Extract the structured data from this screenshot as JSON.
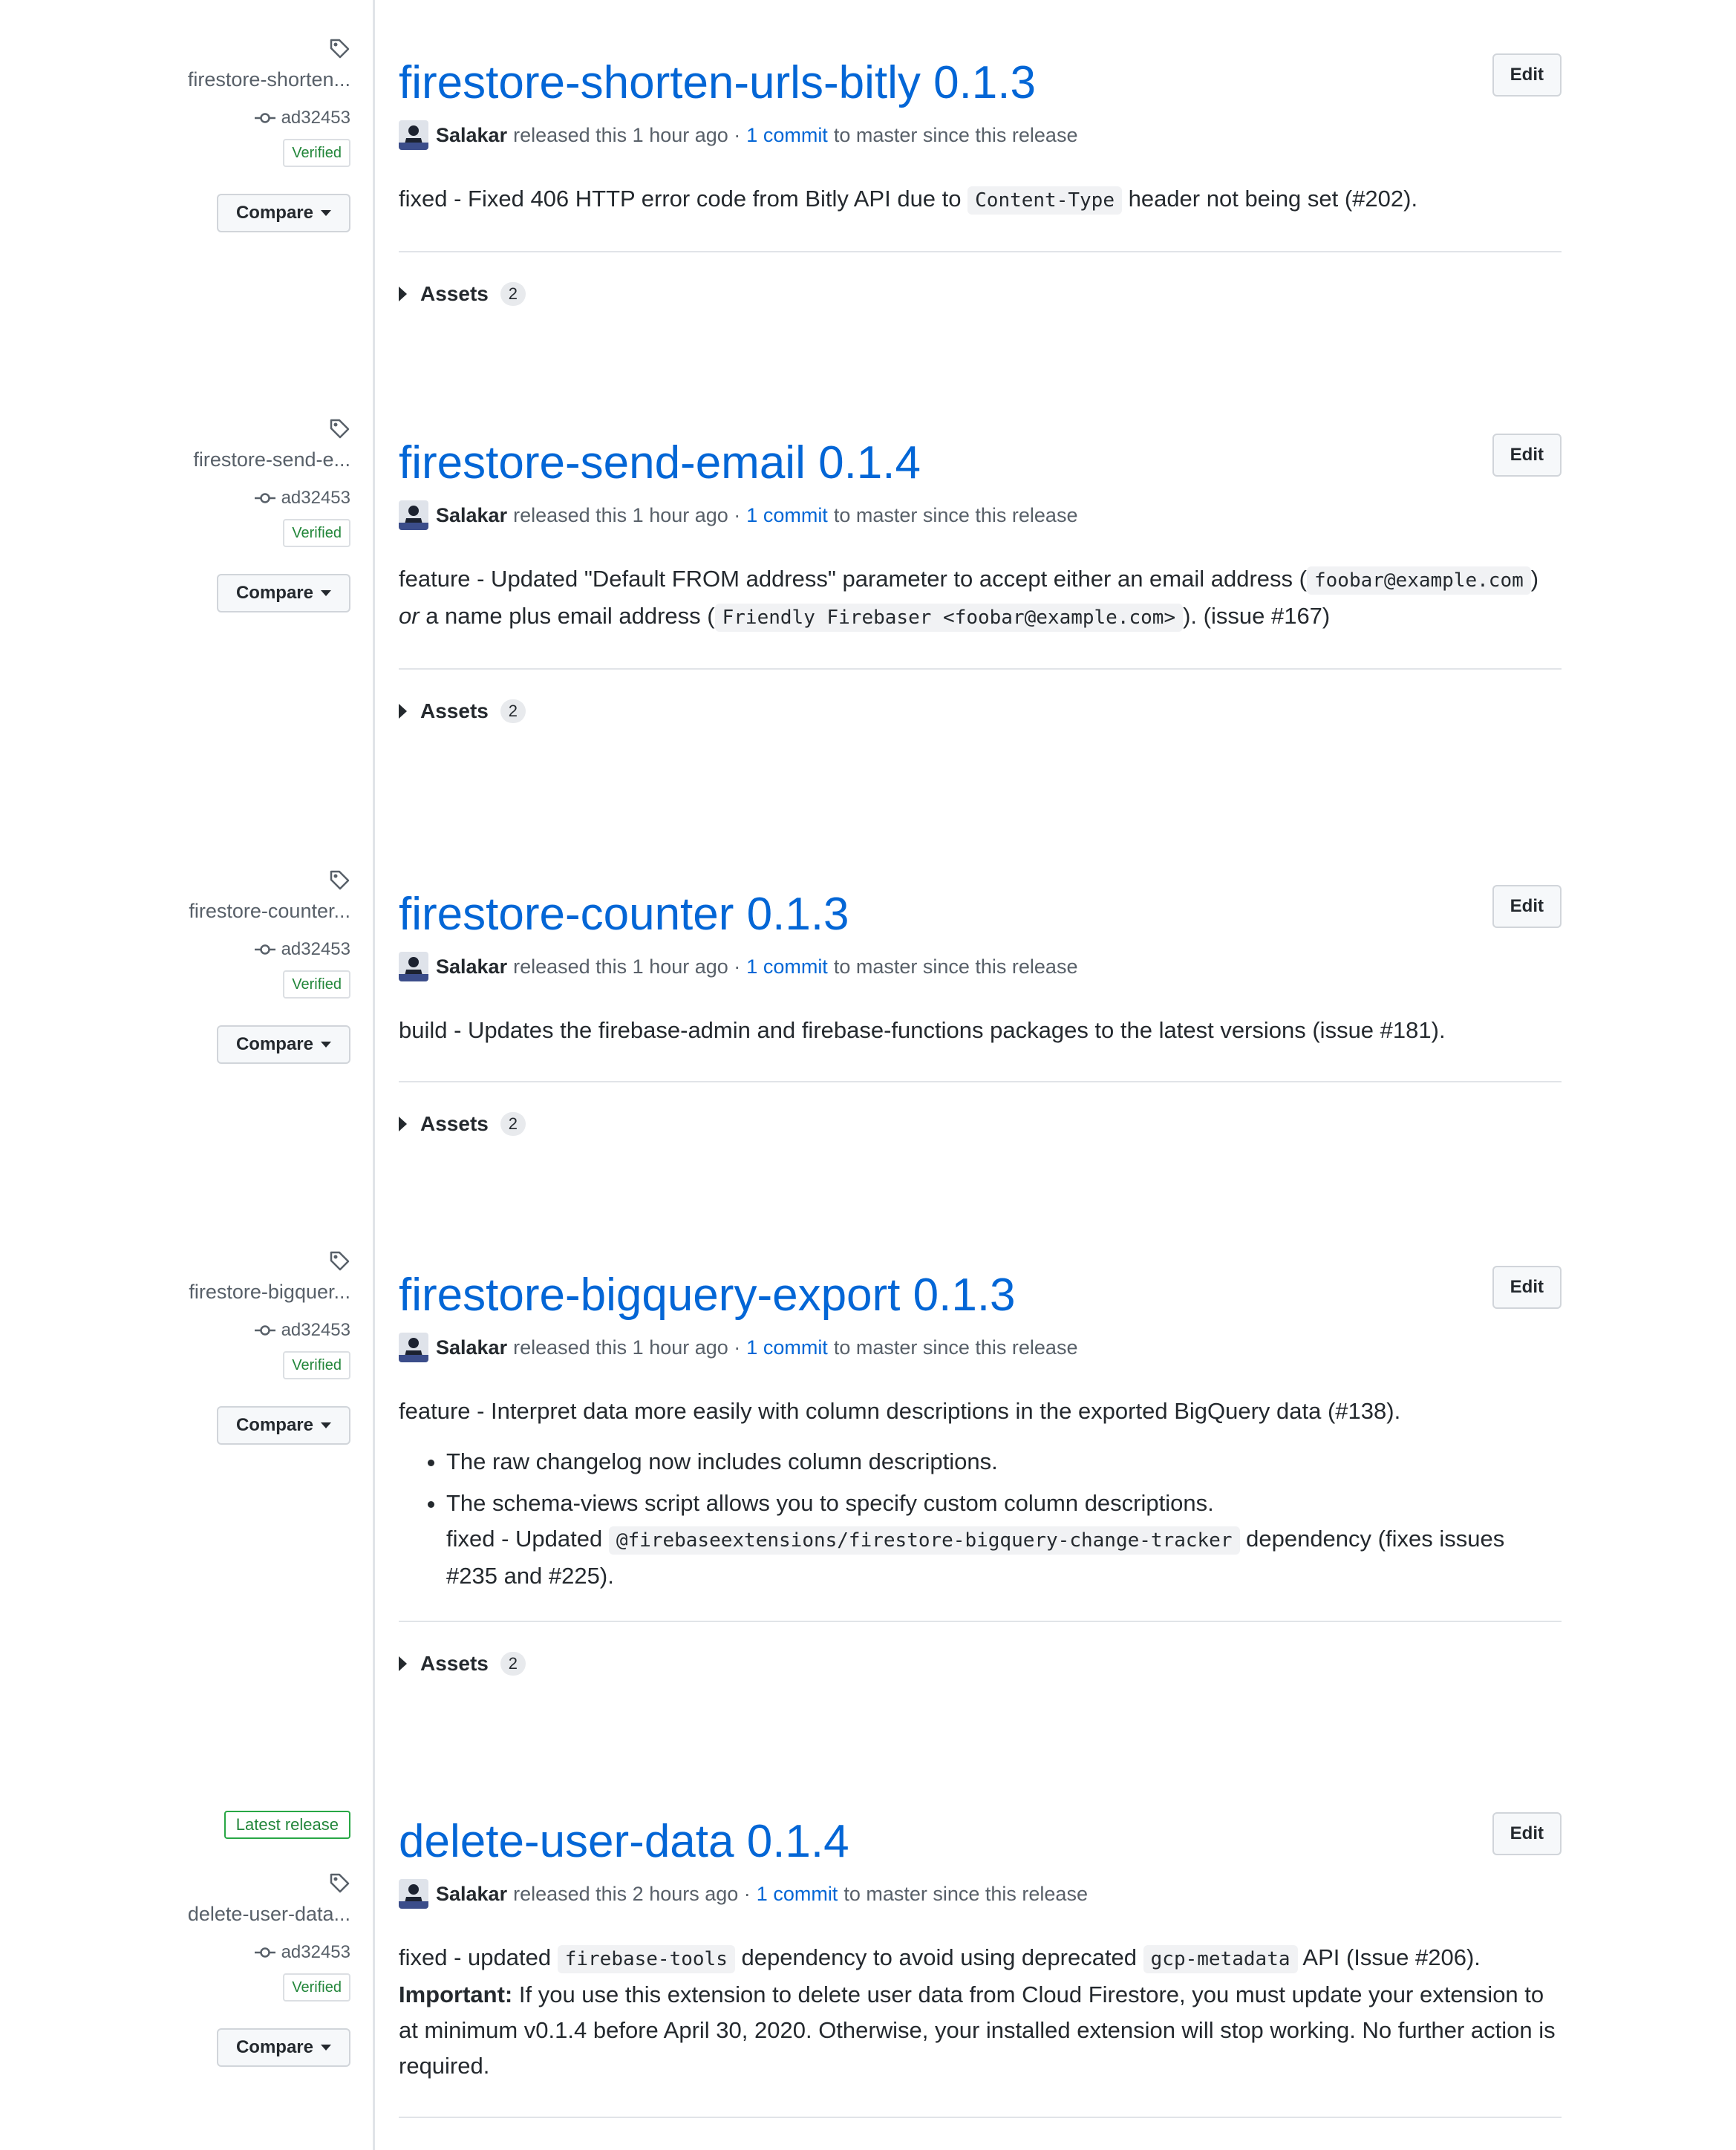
{
  "colors": {
    "accent": "#0366d6",
    "verified_green": "#22863a",
    "muted": "#586069"
  },
  "labels": {
    "edit": "Edit",
    "compare": "Compare",
    "assets": "Assets",
    "verified": "Verified",
    "latest_release": "Latest release",
    "since_text": "to master since this release",
    "commit_link": "1 commit",
    "commit_sha": "ad32453"
  },
  "releases": [
    {
      "tag": "firestore-shorten...",
      "title": "firestore-shorten-urls-bitly 0.1.3",
      "author": "Salakar",
      "released": "released this 1 hour ago ·",
      "assets_count": "2",
      "body": {
        "p1_a": "fixed - Fixed 406 HTTP error code from Bitly API due to ",
        "p1_code": "Content-Type",
        "p1_b": " header not being set (#202)."
      }
    },
    {
      "tag": "firestore-send-e...",
      "title": "firestore-send-email 0.1.4",
      "author": "Salakar",
      "released": "released this 1 hour ago ·",
      "assets_count": "2",
      "body": {
        "p1_a": "feature - Updated \"Default FROM address\" parameter to accept either an email address (",
        "p1_code1": "foobar@example.com",
        "p1_b": ")",
        "p1_or": "or",
        "p1_c": "a name plus email address (",
        "p1_code2": "Friendly Firebaser <foobar@example.com>",
        "p1_d": "). (issue #167)"
      }
    },
    {
      "tag": "firestore-counter...",
      "title": "firestore-counter 0.1.3",
      "author": "Salakar",
      "released": "released this 1 hour ago ·",
      "assets_count": "2",
      "body": {
        "p1": "build - Updates the firebase-admin and firebase-functions packages to the latest versions (issue #181)."
      }
    },
    {
      "tag": "firestore-bigquer...",
      "title": "firestore-bigquery-export 0.1.3",
      "author": "Salakar",
      "released": "released this 1 hour ago ·",
      "assets_count": "2",
      "body": {
        "p1": "feature - Interpret data more easily with column descriptions in the exported BigQuery data (#138).",
        "li1": "The raw changelog now includes column descriptions.",
        "li2_a": "The schema-views script allows you to specify custom column descriptions.",
        "li2_b": "fixed - Updated ",
        "li2_code": "@firebaseextensions/firestore-bigquery-change-tracker",
        "li2_c": " dependency (fixes issues #235 and #225)."
      }
    },
    {
      "tag": "delete-user-data...",
      "title": "delete-user-data 0.1.4",
      "author": "Salakar",
      "released": "released this 2 hours ago ·",
      "body": {
        "p1_a": "fixed - updated ",
        "p1_code1": "firebase-tools",
        "p1_b": " dependency to avoid using deprecated ",
        "p1_code2": "gcp-metadata",
        "p1_c": " API (Issue #206).",
        "important": "Important:",
        "p2": " If you use this extension to delete user data from Cloud Firestore, you must update your extension to at minimum v0.1.4 before April 30, 2020. Otherwise, your installed extension will stop working. No further action is required."
      }
    }
  ]
}
